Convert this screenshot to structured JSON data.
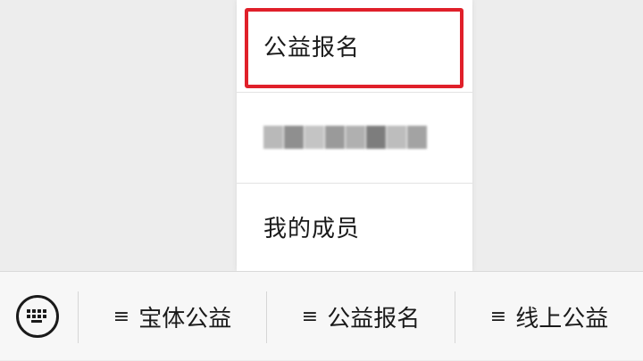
{
  "popup_menu": {
    "items": [
      {
        "label": "公益报名",
        "highlighted": true
      },
      {
        "label": "",
        "obscured": true
      },
      {
        "label": "我的成员"
      }
    ]
  },
  "highlight_color": "#e0202a",
  "bottom_bar": {
    "keyboard_icon": "keyboard-icon",
    "tabs": [
      {
        "icon": "≡",
        "label": "宝体公益"
      },
      {
        "icon": "≡",
        "label": "公益报名"
      },
      {
        "icon": "≡",
        "label": "线上公益"
      }
    ]
  }
}
